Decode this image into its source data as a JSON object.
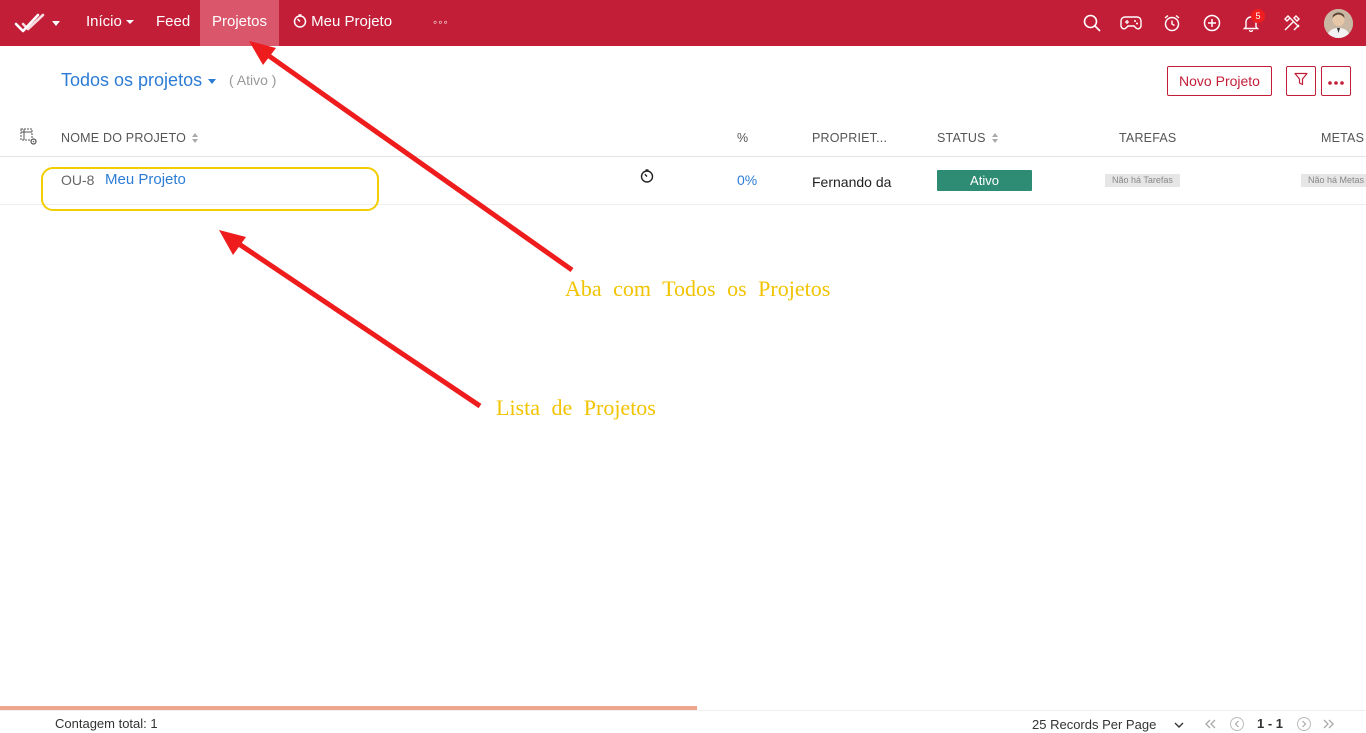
{
  "topbar": {
    "background": "#c21e38",
    "nav": {
      "home": "Início",
      "feed": "Feed",
      "projects": "Projetos",
      "recent_project": "Meu Projeto",
      "more": "◦◦◦"
    },
    "notifications_count": "5",
    "icons": [
      "search-icon",
      "gamepad-icon",
      "alarm-clock-icon",
      "plus-circle-icon",
      "bell-icon",
      "tools-icon"
    ]
  },
  "header": {
    "view_title": "Todos os projetos",
    "view_filter": "( Ativo )",
    "new_project_button": "Novo Projeto"
  },
  "table": {
    "columns": [
      "NOME DO PROJETO",
      "%",
      "PROPRIET...",
      "STATUS",
      "TAREFAS",
      "METAS"
    ],
    "rows": [
      {
        "id": "OU-8",
        "name": "Meu Projeto",
        "percent": "0%",
        "owner": "Fernando da",
        "status": "Ativo",
        "status_color": "#2e8b74",
        "tasks": "Não há Tarefas",
        "goals": "Não há Metas"
      }
    ]
  },
  "annotations": {
    "all_projects_tab": "Aba com Todos os Projetos",
    "project_list": "Lista de Projetos"
  },
  "footer": {
    "total_count": "Contagem total: 1",
    "records_per_page": "25 Records Per Page",
    "page_range": "1 - 1"
  }
}
